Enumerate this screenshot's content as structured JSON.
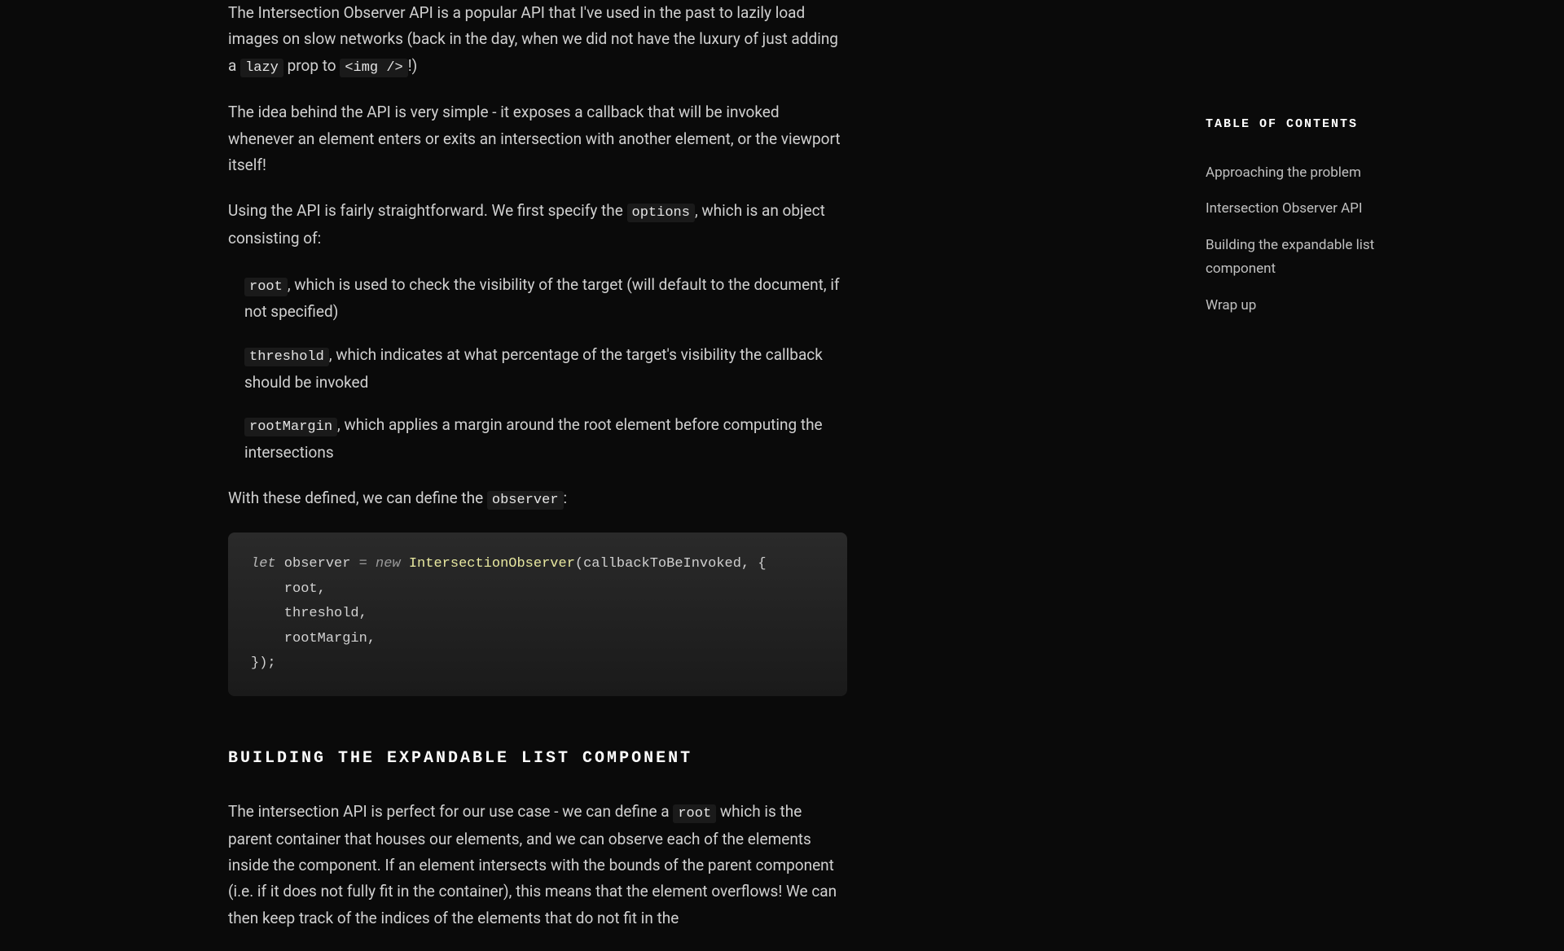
{
  "content": {
    "intro_paragraph": "The Intersection Observer API is a popular API that I've used in the past to lazily load images on slow networks (back in the day, when we did not have the luxury of just adding a ",
    "intro_code1": "lazy",
    "intro_mid": " prop to ",
    "intro_code2": "<img />",
    "intro_end": "!)",
    "para2": "The idea behind the API is very simple - it exposes a callback that will be invoked whenever an element enters or exits an intersection with another element, or the viewport itself!",
    "para3_start": "Using the API is fairly straightforward. We first specify the ",
    "para3_code": "options",
    "para3_end": ", which is an object consisting of:",
    "list_item1_code": "root",
    "list_item1_text": ", which is used to check the visibility of the target (will default to the document, if not specified)",
    "list_item2_code": "threshold",
    "list_item2_text": ", which indicates at what percentage of the target's visibility the callback should be invoked",
    "list_item3_code": "rootMargin",
    "list_item3_text": ", which applies a margin around the root element before computing the intersections",
    "para4_start": "With these defined, we can define the ",
    "para4_code": "observer",
    "para4_end": ":",
    "code_let": "let",
    "code_var": " observer ",
    "code_eq": "=",
    "code_new": " new ",
    "code_class": "IntersectionObserver",
    "code_args": "(callbackToBeInvoked, {",
    "code_line2": "    root,",
    "code_line3": "    threshold,",
    "code_line4": "    rootMargin,",
    "code_line5": "});",
    "section_heading": "BUILDING THE EXPANDABLE LIST COMPONENT",
    "para5_start": "The intersection API is perfect for our use case - we can define a ",
    "para5_code": "root",
    "para5_end": " which is the parent container that houses our elements, and we can observe each of the elements inside the component. If an element intersects with the bounds of the parent component (i.e. if it does not fully fit in the container), this means that the element overflows! We can then keep track of the indices of the elements that do not fit in the"
  },
  "toc": {
    "title": "TABLE OF CONTENTS",
    "items": [
      "Approaching the problem",
      "Intersection Observer API",
      "Building the expandable list component",
      "Wrap up"
    ]
  }
}
